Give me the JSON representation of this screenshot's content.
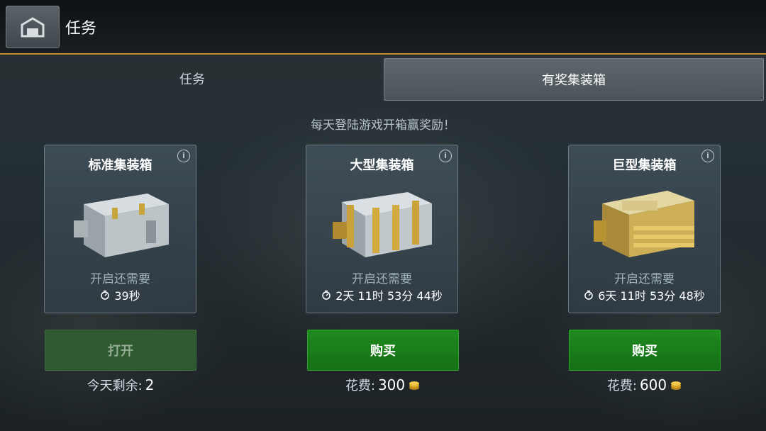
{
  "header": {
    "title": "任务"
  },
  "tabs": [
    {
      "label": "任务",
      "active": false
    },
    {
      "label": "有奖集装箱",
      "active": true
    }
  ],
  "subtitle": "每天登陆游戏开箱赢奖励！",
  "crates": [
    {
      "name": "标准集装箱",
      "open_in_label": "开启还需要",
      "timer": "39秒",
      "button_label": "打开",
      "button_enabled": false,
      "footer_label": "今天剩余:",
      "footer_value": "2",
      "tier": "silver"
    },
    {
      "name": "大型集装箱",
      "open_in_label": "开启还需要",
      "timer": "2天 11时 53分 44秒",
      "button_label": "购买",
      "button_enabled": true,
      "footer_label": "花费:",
      "footer_value": "300",
      "tier": "silver-gold"
    },
    {
      "name": "巨型集装箱",
      "open_in_label": "开启还需要",
      "timer": "6天 11时 53分 48秒",
      "button_label": "购买",
      "button_enabled": true,
      "footer_label": "花费:",
      "footer_value": "600",
      "tier": "gold"
    }
  ],
  "colors": {
    "accent_line": "#c98a3a",
    "buy_button": "#1f8a1f",
    "disabled_button": "#2f5a30"
  }
}
